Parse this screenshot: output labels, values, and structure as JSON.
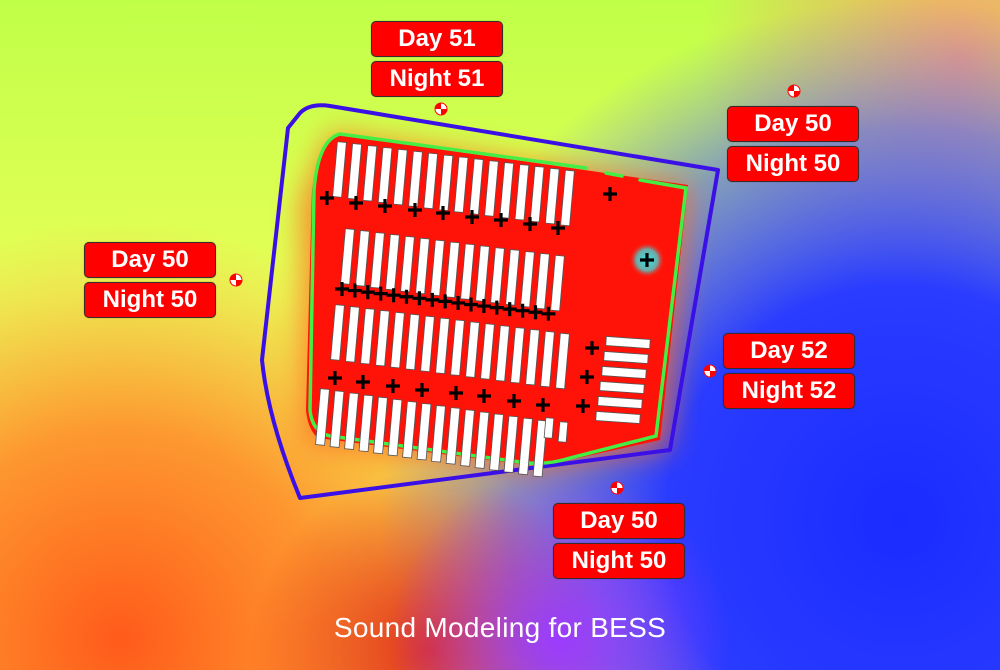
{
  "title": "Sound Modeling for BESS",
  "colors": {
    "label_bg": "#ff0000",
    "label_text": "#ffffff",
    "property_line": "#3a10e6",
    "fence_line": "#44ee44",
    "site_fill": "#ff1a0a",
    "container": "#ffffff",
    "source_marker": "#000000",
    "highlight_glow": "#33dddd"
  },
  "receivers": [
    {
      "id": "north",
      "day_label": "Day 51",
      "night_label": "Night 51",
      "icon": "receiver-target-icon"
    },
    {
      "id": "northeast",
      "day_label": "Day 50",
      "night_label": "Night 50",
      "icon": "receiver-target-icon"
    },
    {
      "id": "west",
      "day_label": "Day 50",
      "night_label": "Night 50",
      "icon": "receiver-target-icon"
    },
    {
      "id": "east",
      "day_label": "Day 52",
      "night_label": "Night 52",
      "icon": "receiver-target-icon"
    },
    {
      "id": "south",
      "day_label": "Day 50",
      "night_label": "Night 50",
      "icon": "receiver-target-icon"
    }
  ],
  "legend_icons": {
    "noise_source": "plus-marker-icon",
    "container": "bess-container-icon"
  }
}
